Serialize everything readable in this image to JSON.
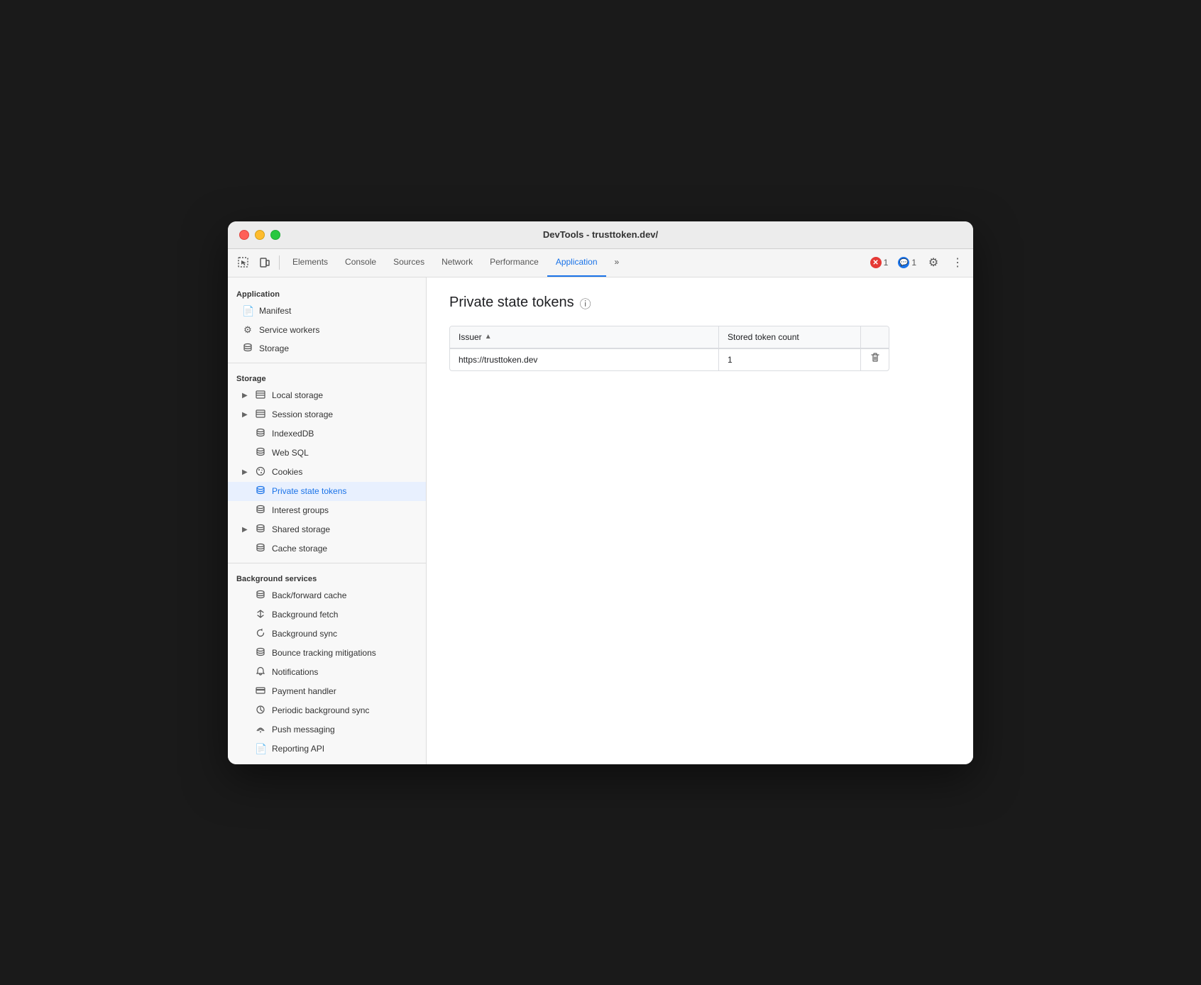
{
  "window": {
    "title": "DevTools - trusttoken.dev/"
  },
  "toolbar": {
    "tabs": [
      {
        "id": "elements",
        "label": "Elements",
        "active": false
      },
      {
        "id": "console",
        "label": "Console",
        "active": false
      },
      {
        "id": "sources",
        "label": "Sources",
        "active": false
      },
      {
        "id": "network",
        "label": "Network",
        "active": false
      },
      {
        "id": "performance",
        "label": "Performance",
        "active": false
      },
      {
        "id": "application",
        "label": "Application",
        "active": true
      },
      {
        "id": "more",
        "label": "»",
        "active": false
      }
    ],
    "error_count": "1",
    "info_count": "1"
  },
  "sidebar": {
    "sections": [
      {
        "id": "application",
        "label": "Application",
        "items": [
          {
            "id": "manifest",
            "label": "Manifest",
            "icon": "📄",
            "indent": false,
            "expandable": false
          },
          {
            "id": "service-workers",
            "label": "Service workers",
            "icon": "⚙️",
            "indent": false,
            "expandable": false
          },
          {
            "id": "storage",
            "label": "Storage",
            "icon": "🗄️",
            "indent": false,
            "expandable": false
          }
        ]
      },
      {
        "id": "storage",
        "label": "Storage",
        "items": [
          {
            "id": "local-storage",
            "label": "Local storage",
            "icon": "⊞",
            "indent": false,
            "expandable": true
          },
          {
            "id": "session-storage",
            "label": "Session storage",
            "icon": "⊞",
            "indent": false,
            "expandable": true
          },
          {
            "id": "indexeddb",
            "label": "IndexedDB",
            "icon": "🗄",
            "indent": false,
            "expandable": false
          },
          {
            "id": "web-sql",
            "label": "Web SQL",
            "icon": "🗄",
            "indent": false,
            "expandable": false
          },
          {
            "id": "cookies",
            "label": "Cookies",
            "icon": "🍪",
            "indent": false,
            "expandable": true
          },
          {
            "id": "private-state-tokens",
            "label": "Private state tokens",
            "icon": "🗄",
            "indent": false,
            "expandable": false,
            "active": true
          },
          {
            "id": "interest-groups",
            "label": "Interest groups",
            "icon": "🗄",
            "indent": false,
            "expandable": false
          },
          {
            "id": "shared-storage",
            "label": "Shared storage",
            "icon": "🗄",
            "indent": false,
            "expandable": true
          },
          {
            "id": "cache-storage",
            "label": "Cache storage",
            "icon": "🗄",
            "indent": false,
            "expandable": false
          }
        ]
      },
      {
        "id": "background-services",
        "label": "Background services",
        "items": [
          {
            "id": "back-forward-cache",
            "label": "Back/forward cache",
            "icon": "🗄",
            "indent": false,
            "expandable": false
          },
          {
            "id": "background-fetch",
            "label": "Background fetch",
            "icon": "↕",
            "indent": false,
            "expandable": false
          },
          {
            "id": "background-sync",
            "label": "Background sync",
            "icon": "↺",
            "indent": false,
            "expandable": false
          },
          {
            "id": "bounce-tracking",
            "label": "Bounce tracking mitigations",
            "icon": "🗄",
            "indent": false,
            "expandable": false
          },
          {
            "id": "notifications",
            "label": "Notifications",
            "icon": "🔔",
            "indent": false,
            "expandable": false
          },
          {
            "id": "payment-handler",
            "label": "Payment handler",
            "icon": "💳",
            "indent": false,
            "expandable": false
          },
          {
            "id": "periodic-background-sync",
            "label": "Periodic background sync",
            "icon": "🕐",
            "indent": false,
            "expandable": false
          },
          {
            "id": "push-messaging",
            "label": "Push messaging",
            "icon": "☁",
            "indent": false,
            "expandable": false
          },
          {
            "id": "reporting-api",
            "label": "Reporting API",
            "icon": "📄",
            "indent": false,
            "expandable": false
          }
        ]
      }
    ]
  },
  "content": {
    "page_title": "Private state tokens",
    "table": {
      "col_issuer": "Issuer",
      "col_count": "Stored token count",
      "rows": [
        {
          "issuer": "https://trusttoken.dev",
          "count": "1"
        }
      ]
    }
  }
}
